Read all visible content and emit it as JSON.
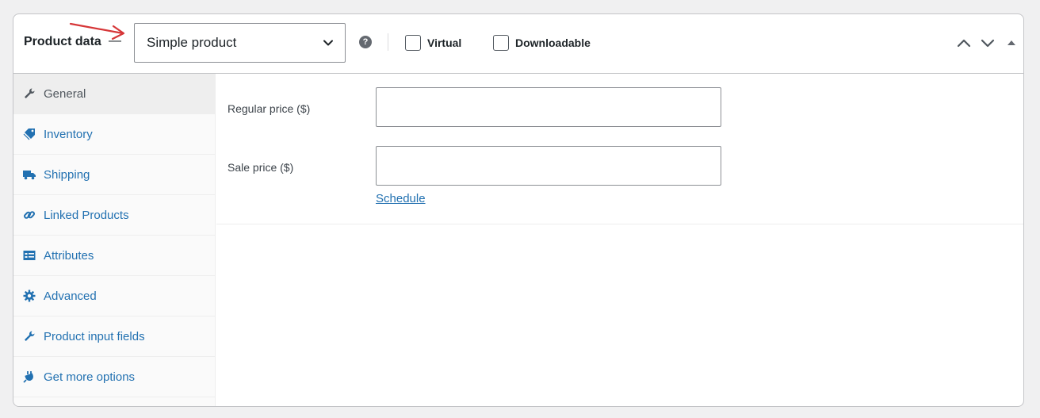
{
  "header": {
    "title": "Product data",
    "dash": "—",
    "product_type": "Simple product",
    "help_glyph": "?",
    "virtual_label": "Virtual",
    "downloadable_label": "Downloadable"
  },
  "tabs": [
    {
      "label": "General",
      "icon": "wrench-icon",
      "active": true
    },
    {
      "label": "Inventory",
      "icon": "tag-icon"
    },
    {
      "label": "Shipping",
      "icon": "truck-icon"
    },
    {
      "label": "Linked Products",
      "icon": "link-icon"
    },
    {
      "label": "Attributes",
      "icon": "list-card-icon"
    },
    {
      "label": "Advanced",
      "icon": "gear-icon"
    },
    {
      "label": "Product input fields",
      "icon": "wrench-icon"
    },
    {
      "label": "Get more options",
      "icon": "plugin-icon"
    }
  ],
  "general": {
    "regular_price_label": "Regular price ($)",
    "regular_price_value": "",
    "sale_price_label": "Sale price ($)",
    "sale_price_value": "",
    "schedule_link": "Schedule"
  },
  "colors": {
    "accent": "#2271b1",
    "annotation_arrow": "#d63638"
  }
}
